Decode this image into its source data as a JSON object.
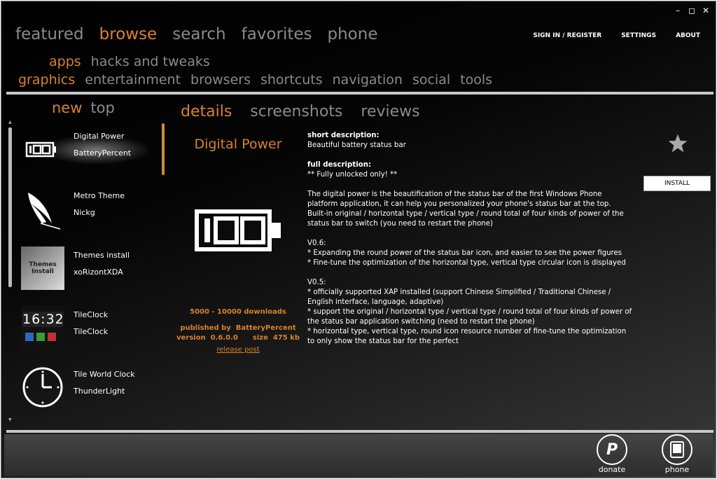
{
  "window": {
    "controls": [
      "–",
      "◻",
      "✕"
    ]
  },
  "nav": {
    "main": [
      "featured",
      "browse",
      "search",
      "favorites",
      "phone"
    ],
    "active": "browse",
    "right": [
      "SIGN IN / REGISTER",
      "SETTINGS",
      "ABOUT"
    ]
  },
  "categories": {
    "row1": [
      "apps",
      "hacks and tweaks"
    ],
    "row2": [
      "graphics",
      "entertainment",
      "browsers",
      "shortcuts",
      "navigation",
      "social",
      "tools"
    ]
  },
  "sort": {
    "new": "new",
    "top": "top"
  },
  "apps": [
    {
      "name": "Digital Power",
      "author": "BatteryPercent"
    },
    {
      "name": "Metro Theme",
      "author": "Nickg"
    },
    {
      "name": "Themes install",
      "author": "xoRizontXDA",
      "thumb_text": "Themes Install"
    },
    {
      "name": "TileClock",
      "author": "TileClock",
      "thumb_text": "16:32"
    },
    {
      "name": "Tile World Clock",
      "author": "ThunderLight"
    }
  ],
  "detail": {
    "tabs": [
      "details",
      "screenshots",
      "reviews"
    ],
    "title": "Digital Power",
    "icon_text": "100",
    "downloads": "5000 - 10000 downloads",
    "published_label": "published by",
    "publisher": "BatteryPercent",
    "version_label": "version",
    "version": "0.6.0.0",
    "size_label": "size",
    "size": "475 kb",
    "release_post": "release post",
    "install": "INSTALL",
    "short_heading": "short description:",
    "short": "Beautiful battery status bar",
    "full_heading": "full description:",
    "full": [
      "** Fully unlocked only! **",
      "",
      "The digital power is the beautification of the status bar of the first Windows Phone platform application, it can help you personalized your phone's status bar at the top.",
      "Built-in original / horizontal type / vertical type / round total of four kinds of power of the status bar to switch (you need to restart the phone)",
      "",
      "V0.6:",
      "* Expanding the round power of the status bar icon, and easier to see the power figures",
      "* Fine-tune the optimization of the horizontal type, vertical type circular icon is displayed",
      "",
      "V0.5:",
      "* officially supported XAP installed (support Chinese Simplified / Traditional Chinese / English interface, language, adaptive)",
      "* support the original / horizontal type / vertical type / round total of four kinds of power of the status bar application switching (need to restart the phone)",
      "* horizontal type, vertical type, round icon resource number of fine-tune the optimization to only show the status bar for the perfect"
    ]
  },
  "dock": {
    "donate": "donate",
    "phone": "phone",
    "donate_icon_text": "P"
  },
  "colors": {
    "accent": "#d9822b",
    "inactive": "#8a8a8a",
    "text": "#ffffff"
  }
}
